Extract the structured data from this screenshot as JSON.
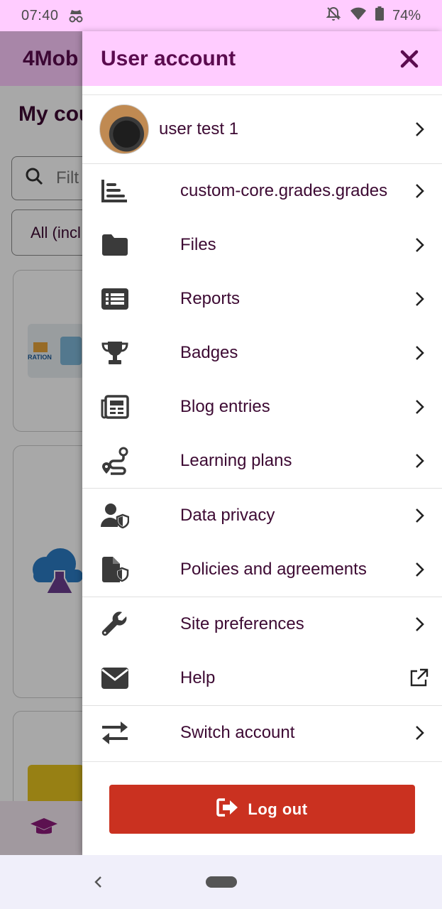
{
  "status_bar": {
    "time": "07:40",
    "battery": "74%"
  },
  "background": {
    "app_title": "4Mob",
    "page_title": "My cou",
    "search_placeholder": "Filt",
    "filter_value": "All (incl",
    "thumb1_text": "RATION"
  },
  "drawer": {
    "title": "User account",
    "user": {
      "name": "user test 1"
    },
    "items": [
      {
        "label": "custom-core.grades.grades",
        "icon": "grades-icon"
      },
      {
        "label": "Files",
        "icon": "folder-icon"
      },
      {
        "label": "Reports",
        "icon": "list-icon"
      },
      {
        "label": "Badges",
        "icon": "trophy-icon"
      },
      {
        "label": "Blog entries",
        "icon": "newspaper-icon"
      },
      {
        "label": "Learning plans",
        "icon": "route-icon"
      },
      {
        "label": "Data privacy",
        "icon": "user-shield-icon"
      },
      {
        "label": "Policies and agreements",
        "icon": "file-shield-icon"
      },
      {
        "label": "Site preferences",
        "icon": "wrench-icon"
      },
      {
        "label": "Help",
        "icon": "envelope-icon",
        "trailing": "external-link-icon"
      },
      {
        "label": "Switch account",
        "icon": "arrows-exchange-icon"
      }
    ],
    "logout_label": "Log out"
  },
  "colors": {
    "header_bg": "#ffccff",
    "title": "#5b0b4f",
    "text": "#3d0a33",
    "logout": "#ca3120"
  }
}
